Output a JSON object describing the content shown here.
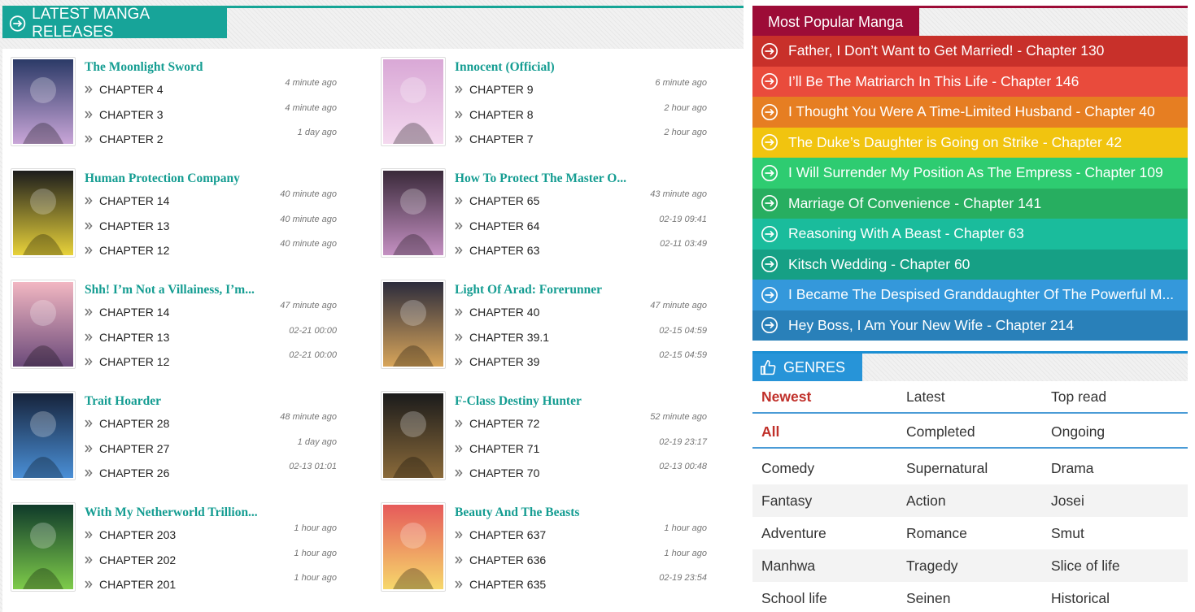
{
  "latest": {
    "title": "LATEST MANGA RELEASES",
    "items": [
      {
        "title": "The Moonlight Sword",
        "chapters": [
          {
            "label": "CHAPTER 4",
            "time": "4 minute ago"
          },
          {
            "label": "CHAPTER 3",
            "time": "4 minute ago"
          },
          {
            "label": "CHAPTER 2",
            "time": "1 day ago"
          }
        ]
      },
      {
        "title": "Innocent (Official)",
        "chapters": [
          {
            "label": "CHAPTER 9",
            "time": "6 minute ago"
          },
          {
            "label": "CHAPTER 8",
            "time": "2 hour ago"
          },
          {
            "label": "CHAPTER 7",
            "time": "2 hour ago"
          }
        ]
      },
      {
        "title": "Human Protection Company",
        "chapters": [
          {
            "label": "CHAPTER 14",
            "time": "40 minute ago"
          },
          {
            "label": "CHAPTER 13",
            "time": "40 minute ago"
          },
          {
            "label": "CHAPTER 12",
            "time": "40 minute ago"
          }
        ]
      },
      {
        "title": "How To Protect The Master O...",
        "chapters": [
          {
            "label": "CHAPTER 65",
            "time": "43 minute ago"
          },
          {
            "label": "CHAPTER 64",
            "time": "02-19 09:41"
          },
          {
            "label": "CHAPTER 63",
            "time": "02-11 03:49"
          }
        ]
      },
      {
        "title": "Shh! I’m Not a Villainess, I’m...",
        "chapters": [
          {
            "label": "CHAPTER 14",
            "time": "47 minute ago"
          },
          {
            "label": "CHAPTER 13",
            "time": "02-21 00:00"
          },
          {
            "label": "CHAPTER 12",
            "time": "02-21 00:00"
          }
        ]
      },
      {
        "title": "Light Of Arad: Forerunner",
        "chapters": [
          {
            "label": "CHAPTER 40",
            "time": "47 minute ago"
          },
          {
            "label": "CHAPTER 39.1",
            "time": "02-15 04:59"
          },
          {
            "label": "CHAPTER 39",
            "time": "02-15 04:59"
          }
        ]
      },
      {
        "title": "Trait Hoarder",
        "chapters": [
          {
            "label": "CHAPTER 28",
            "time": "48 minute ago"
          },
          {
            "label": "CHAPTER 27",
            "time": "1 day ago"
          },
          {
            "label": "CHAPTER 26",
            "time": "02-13 01:01"
          }
        ]
      },
      {
        "title": "F-Class Destiny Hunter",
        "chapters": [
          {
            "label": "CHAPTER 72",
            "time": "52 minute ago"
          },
          {
            "label": "CHAPTER 71",
            "time": "02-19 23:17"
          },
          {
            "label": "CHAPTER 70",
            "time": "02-13 00:48"
          }
        ]
      },
      {
        "title": "With My Netherworld Trillion...",
        "chapters": [
          {
            "label": "CHAPTER 203",
            "time": "1 hour ago"
          },
          {
            "label": "CHAPTER 202",
            "time": "1 hour ago"
          },
          {
            "label": "CHAPTER 201",
            "time": "1 hour ago"
          }
        ]
      },
      {
        "title": "Beauty And The Beasts",
        "chapters": [
          {
            "label": "CHAPTER 637",
            "time": "1 hour ago"
          },
          {
            "label": "CHAPTER 636",
            "time": "1 hour ago"
          },
          {
            "label": "CHAPTER 635",
            "time": "02-19 23:54"
          }
        ]
      }
    ]
  },
  "popular": {
    "title": "Most Popular Manga",
    "items": [
      {
        "label": "Father, I Don’t Want to Get Married! - Chapter 130",
        "color": "#c8302a"
      },
      {
        "label": "I’ll Be The Matriarch In This Life - Chapter 146",
        "color": "#e94b3c"
      },
      {
        "label": "I Thought You Were A Time-Limited Husband - Chapter 40",
        "color": "#e67e22"
      },
      {
        "label": "The Duke’s Daughter is Going on Strike - Chapter 42",
        "color": "#f1c40f"
      },
      {
        "label": "I Will Surrender My Position As The Empress - Chapter 109",
        "color": "#2ecc71"
      },
      {
        "label": "Marriage Of Convenience - Chapter 141",
        "color": "#27ae60"
      },
      {
        "label": "Reasoning With A Beast - Chapter 63",
        "color": "#1abc9c"
      },
      {
        "label": "Kitsch Wedding - Chapter 60",
        "color": "#16a085"
      },
      {
        "label": "I Became The Despised Granddaughter Of The Powerful M...",
        "color": "#3498db"
      },
      {
        "label": "Hey Boss, I Am Your New Wife - Chapter 214",
        "color": "#2980b9"
      }
    ]
  },
  "genres": {
    "title": "GENRES",
    "sort": [
      "Newest",
      "Latest",
      "Top read"
    ],
    "status": [
      "All",
      "Completed",
      "Ongoing"
    ],
    "list": [
      [
        "Comedy",
        "Supernatural",
        "Drama"
      ],
      [
        "Fantasy",
        "Action",
        "Josei"
      ],
      [
        "Adventure",
        "Romance",
        "Smut"
      ],
      [
        "Manhwa",
        "Tragedy",
        "Slice of life"
      ],
      [
        "School life",
        "Seinen",
        "Historical"
      ]
    ]
  },
  "colors": {
    "teal": "#17a499",
    "popular": "#9d0c37",
    "genres": "#2794d8",
    "selected": "#c0302a"
  }
}
